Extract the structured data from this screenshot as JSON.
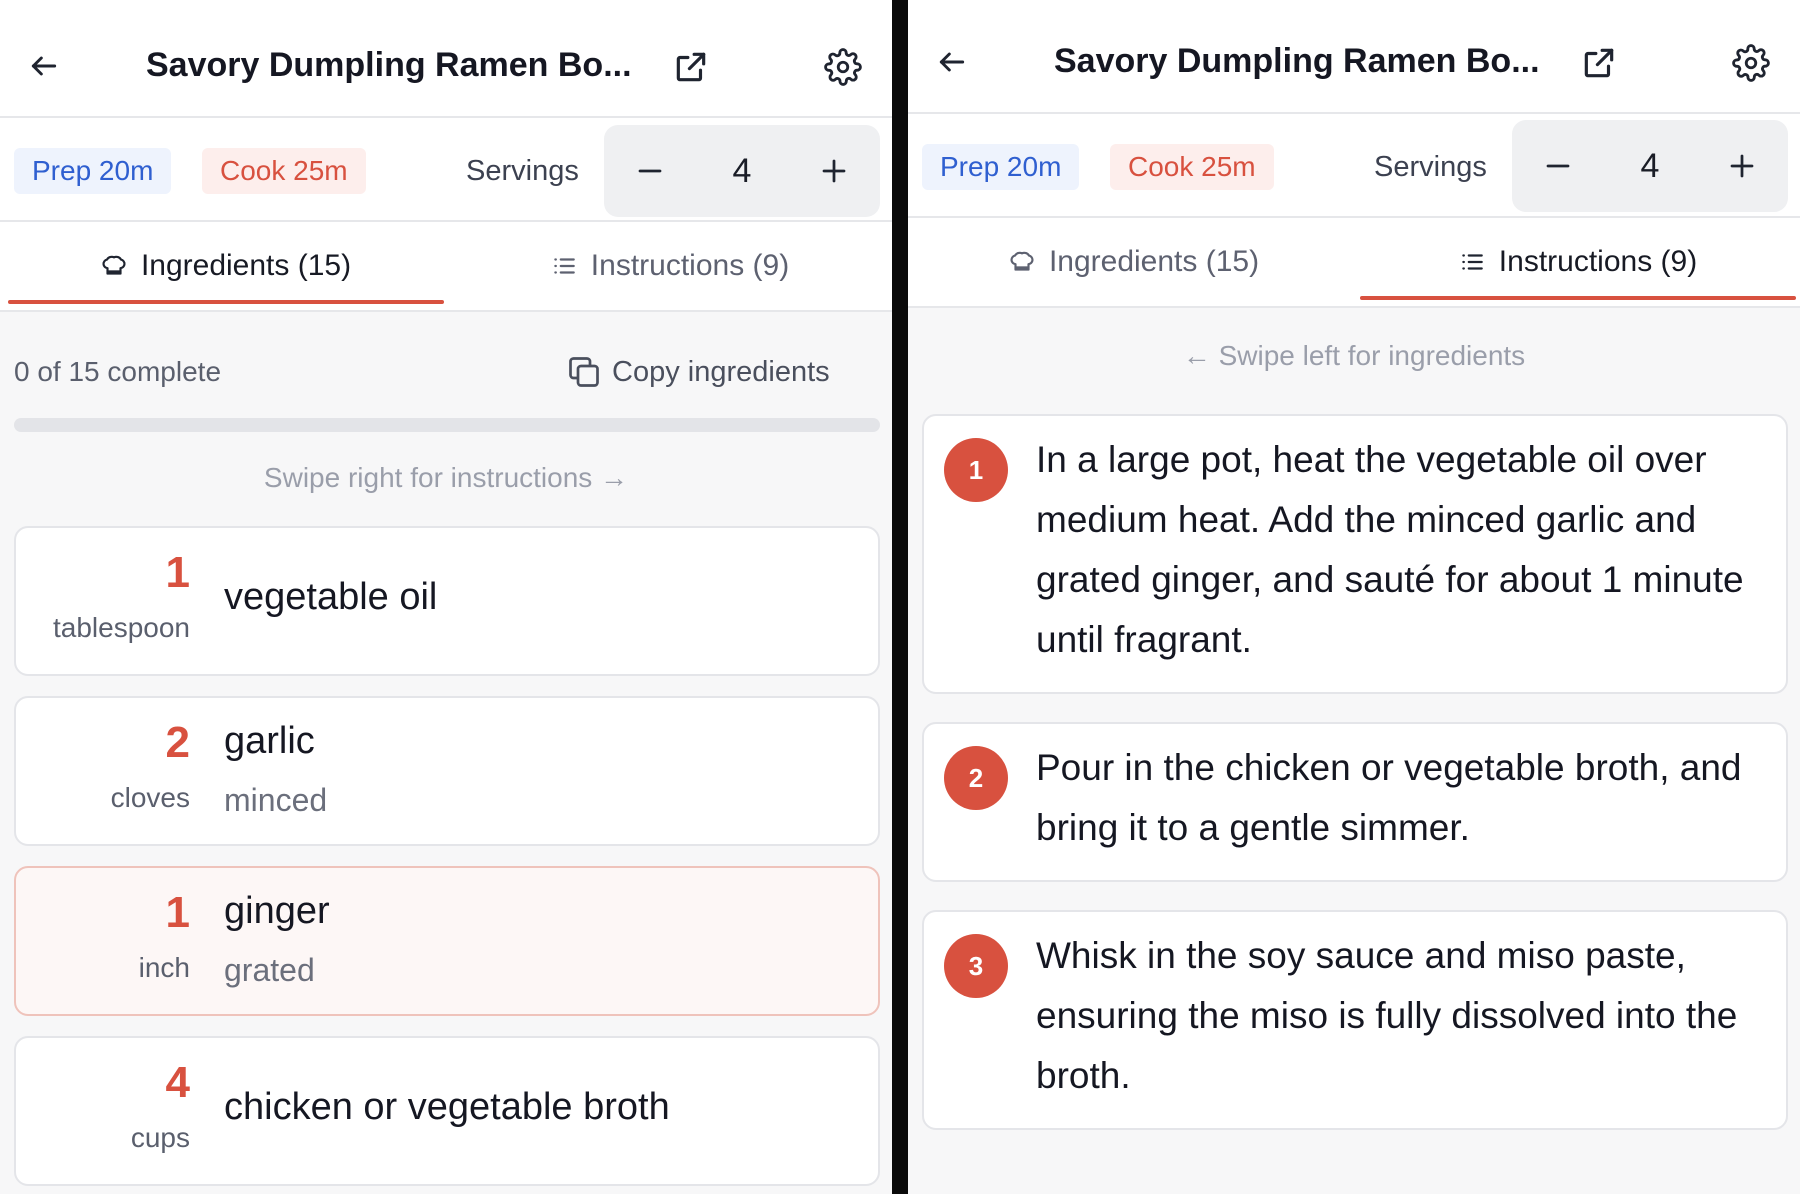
{
  "left": {
    "header": {
      "title": "Savory Dumpling Ramen Bo..."
    },
    "meta": {
      "prep": "Prep 20m",
      "cook": "Cook 25m",
      "servings_label": "Servings",
      "servings_value": "4"
    },
    "tabs": [
      {
        "label": "Ingredients (15)",
        "active": true
      },
      {
        "label": "Instructions (9)",
        "active": false
      }
    ],
    "progress": {
      "label": "0 of 15 complete",
      "fraction": 0
    },
    "copy_label": "Copy ingredients",
    "hint": "Swipe right for instructions →",
    "ingredients": [
      {
        "qty": "1",
        "unit": "tablespoon",
        "name": "vegetable oil",
        "note": ""
      },
      {
        "qty": "2",
        "unit": "cloves",
        "name": "garlic",
        "note": "minced"
      },
      {
        "qty": "1",
        "unit": "inch",
        "name": "ginger",
        "note": "grated"
      },
      {
        "qty": "4",
        "unit": "cups",
        "name": "chicken or vegetable broth",
        "note": ""
      }
    ]
  },
  "right": {
    "header": {
      "title": "Savory Dumpling Ramen Bo..."
    },
    "meta": {
      "prep": "Prep 20m",
      "cook": "Cook 25m",
      "servings_label": "Servings",
      "servings_value": "4"
    },
    "tabs": [
      {
        "label": "Ingredients (15)",
        "active": false
      },
      {
        "label": "Instructions (9)",
        "active": true
      }
    ],
    "hint": "← Swipe left for ingredients",
    "steps": [
      {
        "num": "1",
        "text": "In a large pot, heat the vegetable oil over medium heat. Add the minced garlic and grated ginger, and sauté for about 1 minute until fragrant."
      },
      {
        "num": "2",
        "text": "Pour in the chicken or vegetable broth, and bring it to a gentle simmer."
      },
      {
        "num": "3",
        "text": "Whisk in the soy sauce and miso paste, ensuring the miso is fully dissolved into the broth."
      }
    ]
  },
  "colors": {
    "accent": "#d8513f",
    "prep_chip": "#2f5fd0"
  },
  "icons": [
    "back-arrow-icon",
    "external-link-icon",
    "gear-icon",
    "chef-hat-icon",
    "list-icon",
    "copy-icon",
    "minus-icon",
    "plus-icon"
  ]
}
